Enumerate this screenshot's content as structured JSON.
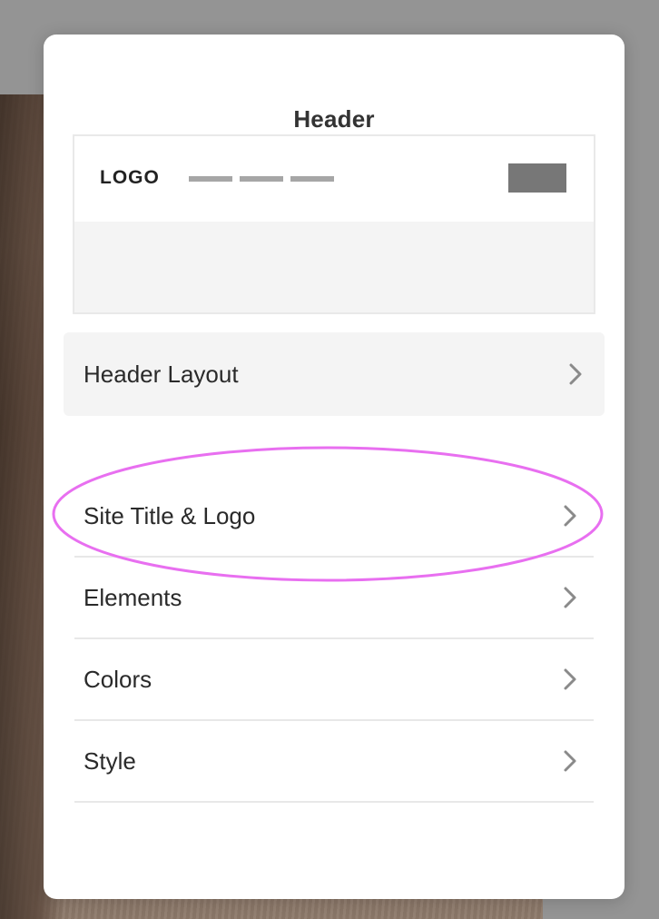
{
  "modal": {
    "title": "Header"
  },
  "preview": {
    "logo_text": "LOGO",
    "nav_items": 3
  },
  "menu": {
    "items": [
      {
        "label": "Header Layout",
        "icon": "chevron-right-icon"
      },
      {
        "label": "Site Title & Logo",
        "icon": "chevron-right-icon"
      },
      {
        "label": "Elements",
        "icon": "chevron-right-icon"
      },
      {
        "label": "Colors",
        "icon": "chevron-right-icon"
      },
      {
        "label": "Style",
        "icon": "chevron-right-icon"
      }
    ]
  },
  "colors": {
    "highlight": "#e86ff0",
    "overlay": "#949494",
    "chevron": "#8a8a8a"
  }
}
